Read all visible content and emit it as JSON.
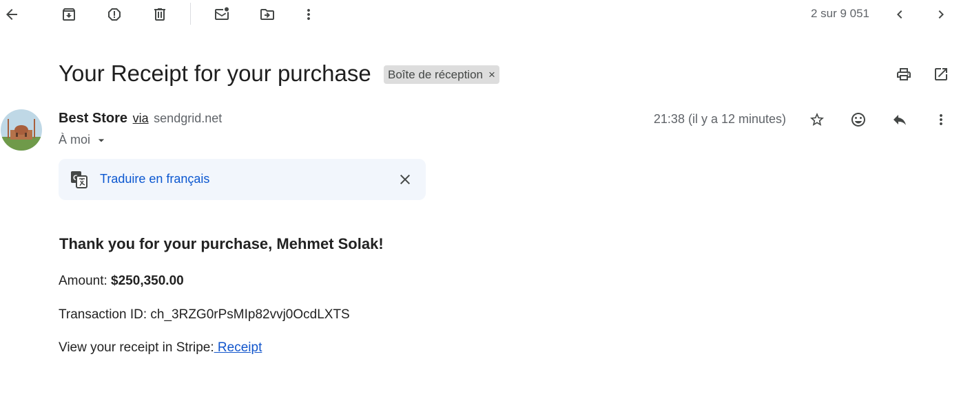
{
  "toolbar": {
    "back": "arrow-back-icon",
    "archive": "archive-icon",
    "spam": "report-spam-icon",
    "delete": "trash-icon",
    "mark_unread": "mark-unread-icon",
    "move_to": "move-to-icon",
    "more": "more-vert-icon",
    "counter": "2 sur 9 051",
    "prev": "chevron-left-icon",
    "next": "chevron-right-icon"
  },
  "email": {
    "subject": "Your Receipt for your purchase",
    "label": "Boîte de réception",
    "label_remove": "×",
    "sender_name": "Best Store",
    "via": "via",
    "sender_domain": "sendgrid.net",
    "recipient": "À moi",
    "time": "21:38 (il y a 12 minutes)"
  },
  "translate": {
    "link": "Traduire en français"
  },
  "content": {
    "heading": "Thank you for your purchase, Mehmet Solak!",
    "amount_label": "Amount: ",
    "amount_value": "$250,350.00",
    "transaction": "Transaction ID: ch_3RZG0rPsMIp82vvj0OcdLXTS",
    "receipt_prefix": "View your receipt in Stripe:",
    "receipt_link": " Receipt"
  },
  "colors": {
    "link": "#0b57d0",
    "chip_bg": "#dddddd",
    "translate_bg": "#f2f6fc"
  }
}
